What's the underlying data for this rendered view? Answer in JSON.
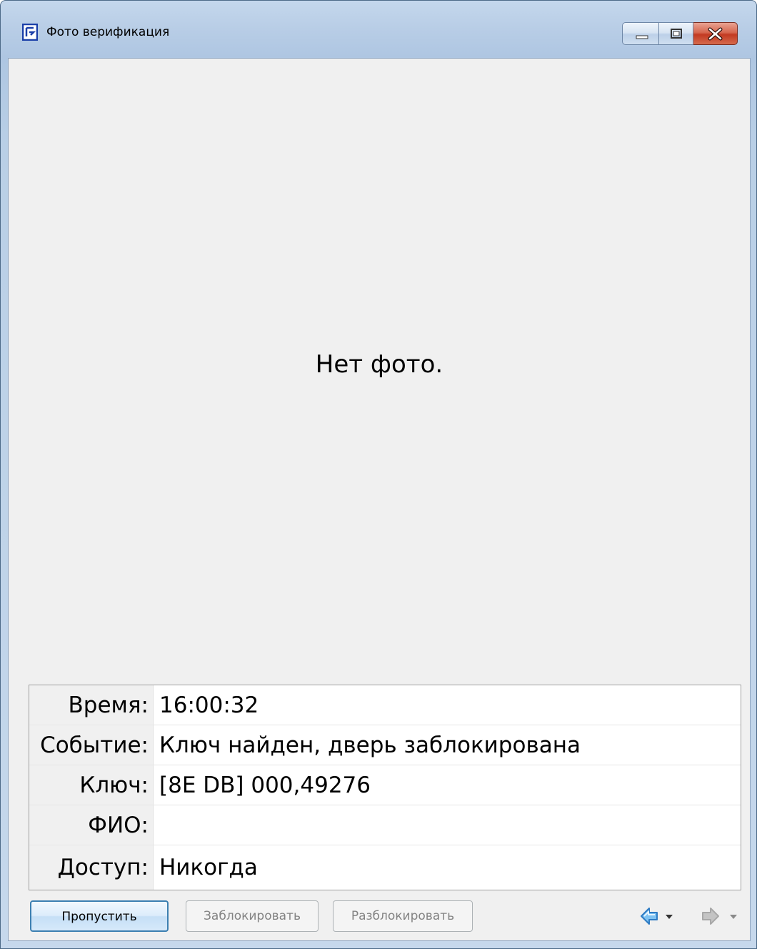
{
  "window": {
    "title": "Фото верификация"
  },
  "photo": {
    "placeholder": "Нет фото."
  },
  "info": {
    "rows": [
      {
        "label": "Время:",
        "value": "16:00:32"
      },
      {
        "label": "Событие:",
        "value": "Ключ найден, дверь заблокирована"
      },
      {
        "label": "Ключ:",
        "value": "[8E DB] 000,49276"
      },
      {
        "label": "ФИО:",
        "value": ""
      },
      {
        "label": "Доступ:",
        "value": "Никогда"
      }
    ]
  },
  "buttons": {
    "skip": "Пропустить",
    "block": "Заблокировать",
    "unblock": "Разблокировать"
  },
  "icons": {
    "app": "app-logo-icon",
    "back": "arrow-left-icon",
    "forward": "arrow-right-icon"
  },
  "colors": {
    "title_bar": "#b9cfe6",
    "client_bg": "#f0f0f0",
    "close_button": "#c23a22",
    "primary_button_border": "#3c7fb1",
    "back_arrow": "#3d8fd6",
    "forward_arrow_disabled": "#b4b4b4"
  }
}
